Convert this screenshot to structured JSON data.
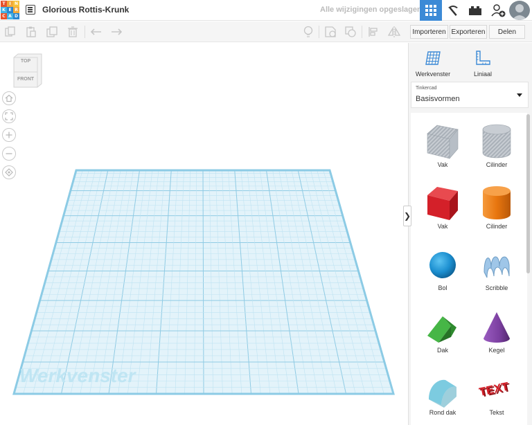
{
  "header": {
    "logo_letters": [
      "T",
      "I",
      "N",
      "K",
      "E",
      "R",
      "C",
      "A",
      "D"
    ],
    "logo_colors": [
      "#e8532c",
      "#f2a93b",
      "#f6c33b",
      "#42b3e5",
      "#2a86cf",
      "#f2a93b",
      "#e8532c",
      "#42b3e5",
      "#2a86cf"
    ],
    "project_title": "Glorious Rottis-Krunk",
    "save_status": "Alle wijzigingen opgeslagen",
    "accent_color": "#3c8ad6",
    "icons": [
      "grid-view-icon",
      "pickaxe-icon",
      "bricks-icon",
      "add-user-icon",
      "avatar"
    ]
  },
  "toolbar": {
    "left_icons": [
      "copy-icon",
      "paste-icon",
      "duplicate-icon",
      "delete-icon",
      "undo-icon",
      "redo-icon"
    ],
    "right_icons": [
      "light-bulb-icon",
      "note-icon",
      "group-icon",
      "align-icon",
      "mirror-icon"
    ],
    "import_label": "Importeren",
    "export_label": "Exporteren",
    "share_label": "Delen"
  },
  "viewcube": {
    "top": "TOP",
    "front": "FRONT"
  },
  "view_controls": [
    "home-view-icon",
    "fit-view-icon",
    "zoom-in-icon",
    "zoom-out-icon",
    "perspective-icon"
  ],
  "workplane": {
    "label": "Werkvenster",
    "color": "#a7d8ec"
  },
  "panel": {
    "workplane_tool_label": "Werkvenster",
    "ruler_tool_label": "Liniaal",
    "library_small": "Tinkercad",
    "library_main": "Basisvormen",
    "collapse_glyph": "❯"
  },
  "shapes": [
    {
      "label": "Vak",
      "icon": "hole-box-icon",
      "color": "#b8bfc7"
    },
    {
      "label": "Cilinder",
      "icon": "hole-cylinder-icon",
      "color": "#b8bfc7"
    },
    {
      "label": "Vak",
      "icon": "box-icon",
      "color": "#d42029"
    },
    {
      "label": "Cilinder",
      "icon": "cylinder-icon",
      "color": "#e8760f"
    },
    {
      "label": "Bol",
      "icon": "sphere-icon",
      "color": "#1c8fd0"
    },
    {
      "label": "Scribble",
      "icon": "scribble-icon",
      "color": "#9fc6e8"
    },
    {
      "label": "Dak",
      "icon": "roof-icon",
      "color": "#3aa23a"
    },
    {
      "label": "Kegel",
      "icon": "cone-icon",
      "color": "#7b3fa0"
    },
    {
      "label": "Rond dak",
      "icon": "round-roof-icon",
      "color": "#6bbcd1"
    },
    {
      "label": "Tekst",
      "icon": "text-icon",
      "color": "#d42029"
    }
  ]
}
